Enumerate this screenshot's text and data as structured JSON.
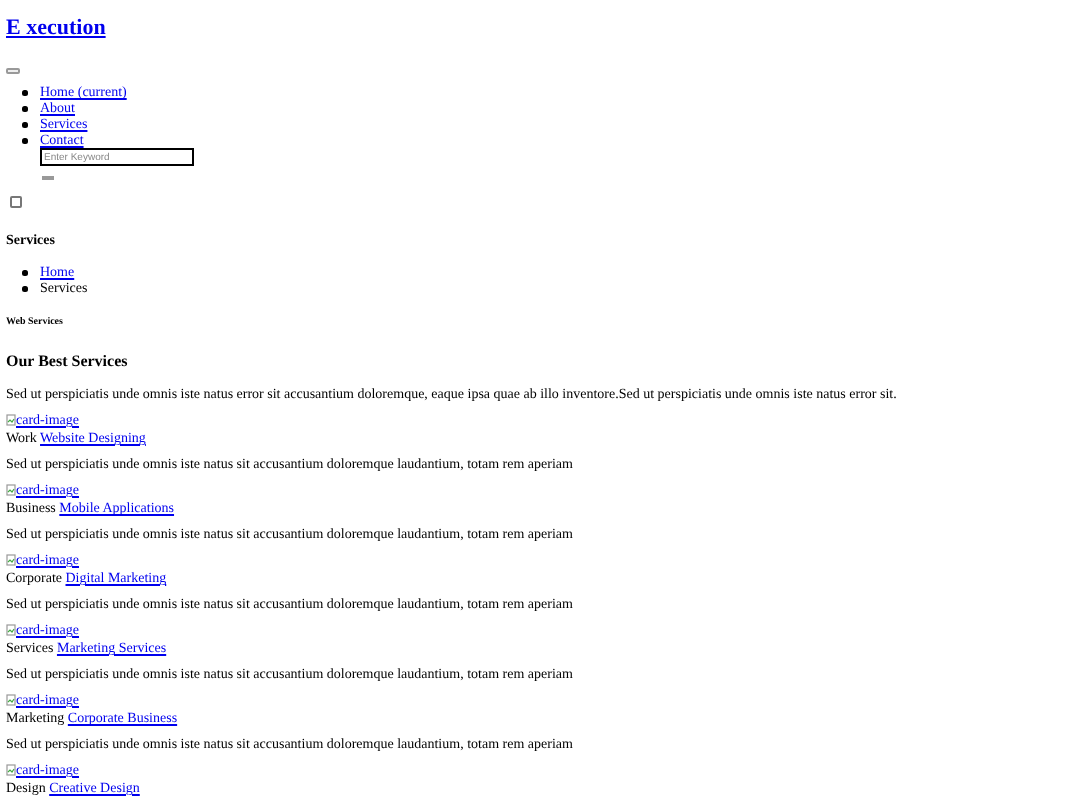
{
  "logo": "E xecution",
  "nav": [
    {
      "label": "Home (current)"
    },
    {
      "label": "About"
    },
    {
      "label": "Services"
    },
    {
      "label": "Contact"
    }
  ],
  "search": {
    "placeholder": "Enter Keyword"
  },
  "menu_checkbox": {
    "checked": false
  },
  "page_title": "Services",
  "breadcrumb": [
    {
      "label": "Home",
      "link": true
    },
    {
      "label": "Services",
      "link": false
    }
  ],
  "section_label": "Web Services",
  "section_title": "Our Best Services",
  "intro": "Sed ut perspiciatis unde omnis iste natus error sit accusantium doloremque, eaque ipsa quae ab illo inventore.Sed ut perspiciatis unde omnis iste natus error sit.",
  "cards": [
    {
      "image_alt": "card-image",
      "category": "Work",
      "title": "Website Designing",
      "text": "Sed ut perspiciatis unde omnis iste natus sit accusantium doloremque laudantium, totam rem aperiam"
    },
    {
      "image_alt": "card-image",
      "category": "Business",
      "title": "Mobile Applications",
      "text": "Sed ut perspiciatis unde omnis iste natus sit accusantium doloremque laudantium, totam rem aperiam"
    },
    {
      "image_alt": "card-image",
      "category": "Corporate",
      "title": "Digital Marketing",
      "text": "Sed ut perspiciatis unde omnis iste natus sit accusantium doloremque laudantium, totam rem aperiam"
    },
    {
      "image_alt": "card-image",
      "category": "Services",
      "title": "Marketing Services",
      "text": "Sed ut perspiciatis unde omnis iste natus sit accusantium doloremque laudantium, totam rem aperiam"
    },
    {
      "image_alt": "card-image",
      "category": "Marketing",
      "title": "Corporate Business",
      "text": "Sed ut perspiciatis unde omnis iste natus sit accusantium doloremque laudantium, totam rem aperiam"
    },
    {
      "image_alt": "card-image",
      "category": "Design",
      "title": "Creative Design"
    }
  ]
}
